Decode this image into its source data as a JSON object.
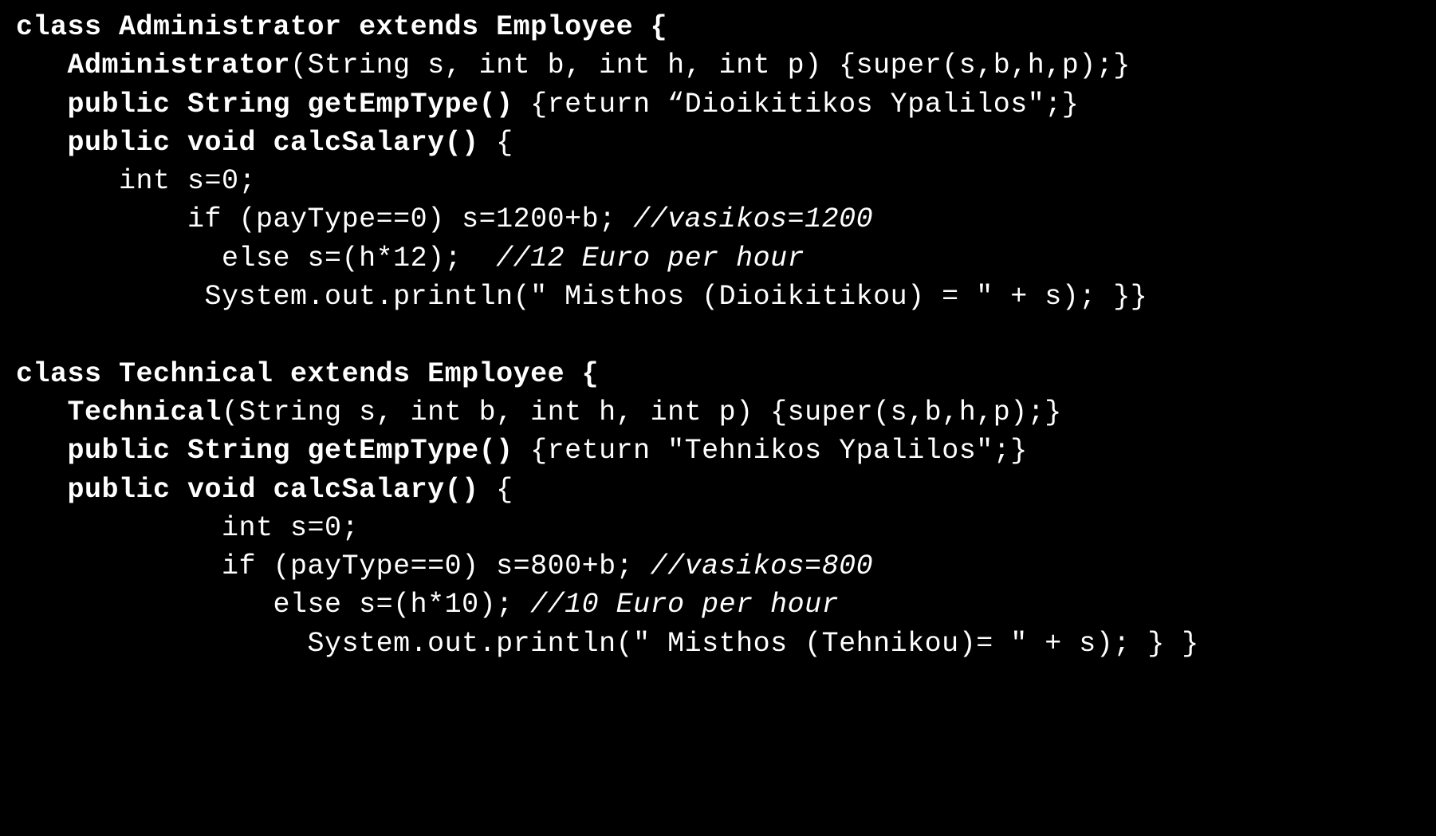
{
  "code": {
    "lines": [
      {
        "parts": [
          {
            "t": "class Administrator extends Employee {",
            "b": true,
            "i": false
          }
        ]
      },
      {
        "parts": [
          {
            "t": "   Administrator",
            "b": true,
            "i": false
          },
          {
            "t": "(String s, int b, int h, int p) {super(s,b,h,p);}",
            "b": false,
            "i": false
          }
        ]
      },
      {
        "parts": [
          {
            "t": "   public String getEmpType()",
            "b": true,
            "i": false
          },
          {
            "t": " {return “Dioikitikos Ypalilos\";}",
            "b": false,
            "i": false
          }
        ]
      },
      {
        "parts": [
          {
            "t": "   public void calcSalary()",
            "b": true,
            "i": false
          },
          {
            "t": " {",
            "b": false,
            "i": false
          }
        ]
      },
      {
        "parts": [
          {
            "t": "      int s=0;",
            "b": false,
            "i": false
          }
        ]
      },
      {
        "parts": [
          {
            "t": "          if (payType==0) s=1200+b; ",
            "b": false,
            "i": false
          },
          {
            "t": "//vasikos=1200",
            "b": false,
            "i": true
          }
        ]
      },
      {
        "parts": [
          {
            "t": "            else s=(h*12);  ",
            "b": false,
            "i": false
          },
          {
            "t": "//12 Euro per hour",
            "b": false,
            "i": true
          }
        ]
      },
      {
        "parts": [
          {
            "t": "           System.out.println(\" Misthos (Dioikitikou) = \" + s); }}",
            "b": false,
            "i": false
          }
        ]
      },
      {
        "parts": [
          {
            "t": "",
            "b": false,
            "i": false
          }
        ]
      },
      {
        "parts": [
          {
            "t": "class Technical extends Employee {",
            "b": true,
            "i": false
          }
        ]
      },
      {
        "parts": [
          {
            "t": "   Technical",
            "b": true,
            "i": false
          },
          {
            "t": "(String s, int b, int h, int p) {super(s,b,h,p);}",
            "b": false,
            "i": false
          }
        ]
      },
      {
        "parts": [
          {
            "t": "   public String getEmpType()",
            "b": true,
            "i": false
          },
          {
            "t": " {return \"Tehnikos Ypalilos\";}",
            "b": false,
            "i": false
          }
        ]
      },
      {
        "parts": [
          {
            "t": "   public void calcSalary()",
            "b": true,
            "i": false
          },
          {
            "t": " {",
            "b": false,
            "i": false
          }
        ]
      },
      {
        "parts": [
          {
            "t": "            int s=0;",
            "b": false,
            "i": false
          }
        ]
      },
      {
        "parts": [
          {
            "t": "            if (payType==0) s=800+b; ",
            "b": false,
            "i": false
          },
          {
            "t": "//vasikos=800",
            "b": false,
            "i": true
          }
        ]
      },
      {
        "parts": [
          {
            "t": "               else s=(h*10); ",
            "b": false,
            "i": false
          },
          {
            "t": "//10 Euro per hour",
            "b": false,
            "i": true
          }
        ]
      },
      {
        "parts": [
          {
            "t": "                 System.out.println(\" Misthos (Tehnikou)= \" + s); } }",
            "b": false,
            "i": false
          }
        ]
      }
    ]
  }
}
